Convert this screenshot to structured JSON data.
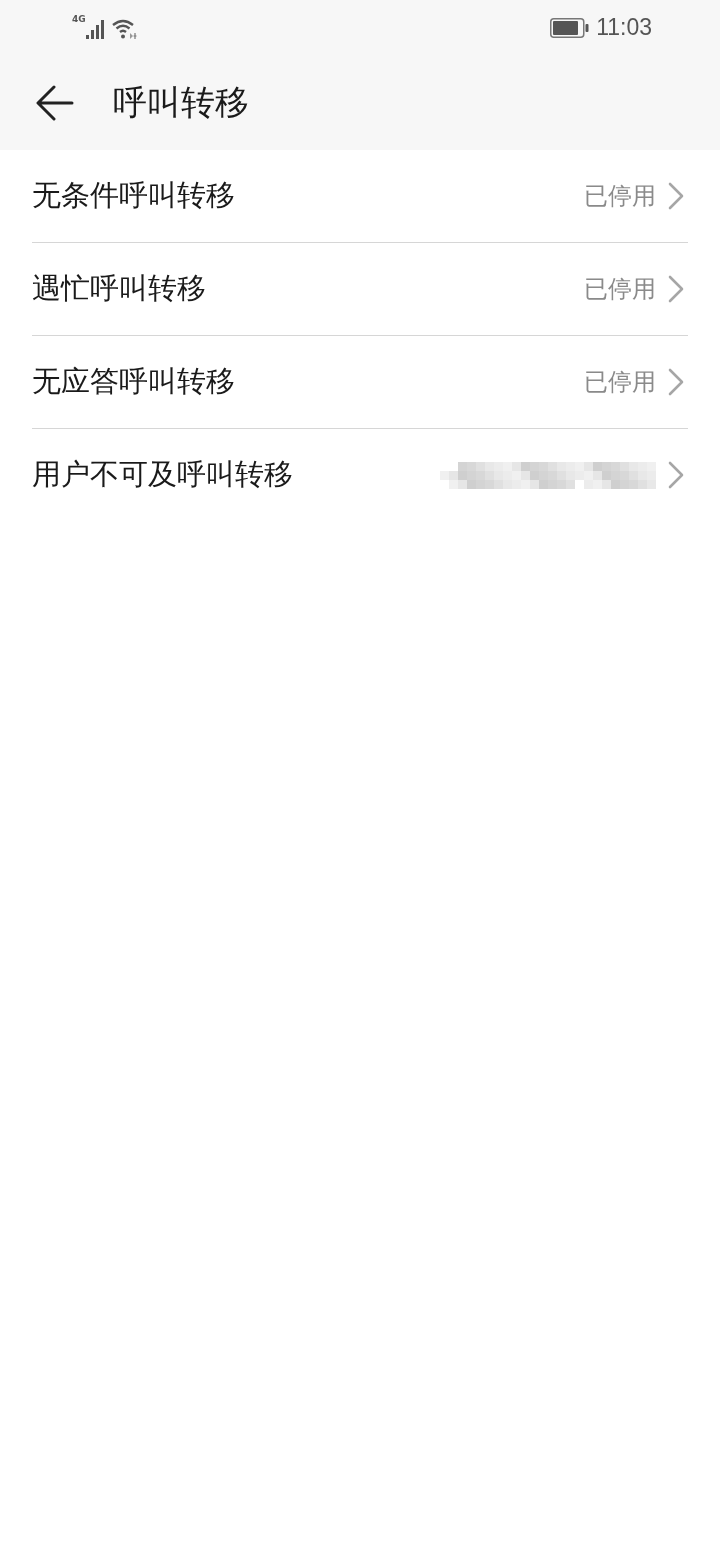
{
  "status_bar": {
    "network": "4G",
    "time": "11:03"
  },
  "app_bar": {
    "title": "呼叫转移"
  },
  "items": [
    {
      "label": "无条件呼叫转移",
      "kind": "status",
      "value": "已停用"
    },
    {
      "label": "遇忙呼叫转移",
      "kind": "status",
      "value": "已停用"
    },
    {
      "label": "无应答呼叫转移",
      "kind": "status",
      "value": "已停用"
    },
    {
      "label": "用户不可及呼叫转移",
      "kind": "redacted"
    }
  ]
}
